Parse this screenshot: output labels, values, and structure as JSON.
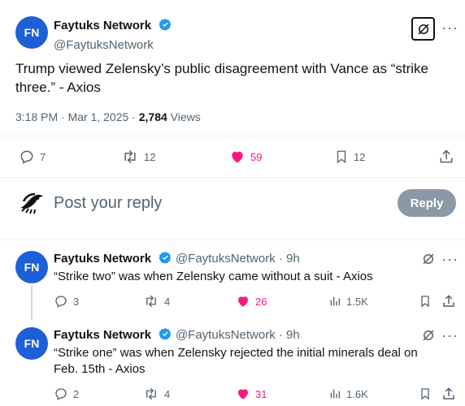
{
  "main_tweet": {
    "author_name": "Faytuks Network",
    "author_handle": "@FaytuksNetwork",
    "avatar_text": "FN",
    "text": "Trump viewed Zelensky’s public disagreement with Vance as “strike three.” - Axios",
    "time": "3:18 PM · Mar 1, 2025 · ",
    "views_count": "2,784",
    "views_label": " Views",
    "replies": "7",
    "retweets": "12",
    "likes": "59",
    "bookmarks": "12"
  },
  "compose": {
    "placeholder": "Post your reply",
    "button": "Reply"
  },
  "replies": [
    {
      "author_name": "Faytuks Network",
      "author_handle": "@FaytuksNetwork · 9h",
      "avatar_text": "FN",
      "text": "“Strike two” was when Zelensky came without a suit - Axios",
      "replies": "3",
      "retweets": "4",
      "likes": "26",
      "views": "1.5K"
    },
    {
      "author_name": "Faytuks Network",
      "author_handle": "@FaytuksNetwork · 9h",
      "avatar_text": "FN",
      "text": "“Strike one” was when Zelensky rejected the initial minerals deal on Feb. 15th - Axios",
      "replies": "2",
      "retweets": "4",
      "likes": "31",
      "views": "1.6K"
    }
  ],
  "colors": {
    "like": "#f91880",
    "verified": "#1d9bf0",
    "muted": "#536471",
    "reply_button": "#8b98a5"
  }
}
